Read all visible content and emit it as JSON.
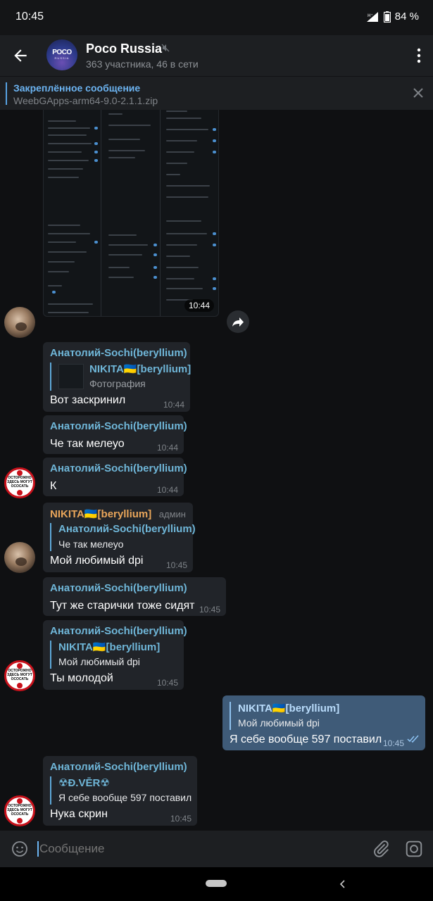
{
  "status": {
    "time": "10:45",
    "network": "H⁺",
    "battery": "84 %"
  },
  "header": {
    "title": "Poco Russia",
    "subtitle": "363 участника, 46 в сети",
    "avatar_logo": "POCO",
    "avatar_sub": "RUSSIA"
  },
  "pinned": {
    "title": "Закреплённое сообщение",
    "text": "WeebGApps-arm64-9.0-2.1.1.zip"
  },
  "photo_time": "10:44",
  "messages": [
    {
      "name": "Анатолий-Sochi(beryllium)",
      "reply_name": "NIKITA🇺🇦[beryllium]",
      "reply_text": "Фотография",
      "text": "Вот заскринил",
      "time": "10:44"
    },
    {
      "name": "Анатолий-Sochi(beryllium)",
      "text": "Че так мелеуо",
      "time": "10:44"
    },
    {
      "name": "Анатолий-Sochi(beryllium)",
      "text": "К",
      "time": "10:44"
    },
    {
      "name": "NIKITA🇺🇦[beryllium]",
      "role": "админ",
      "reply_name": "Анатолий-Sochi(beryllium)",
      "reply_text": "Че так мелеуо",
      "text": "Мой любимый dpi",
      "time": "10:45"
    },
    {
      "name": "Анатолий-Sochi(beryllium)",
      "text": "Тут же старички тоже сидят",
      "time": "10:45"
    },
    {
      "name": "Анатолий-Sochi(beryllium)",
      "reply_name": "NIKITA🇺🇦[beryllium]",
      "reply_text": "Мой любимый dpi",
      "text": "Ты молодой",
      "time": "10:45"
    },
    {
      "reply_name": "NIKITA🇺🇦[beryllium]",
      "reply_text": "Мой любимый dpi",
      "text": "Я себе вообще 597 поставил",
      "time": "10:45"
    },
    {
      "name": "Анатолий-Sochi(beryllium)",
      "reply_name": "☢Ð.VĒR☢",
      "reply_text": "Я себе вообще 597 поставил",
      "text": "Нука скрин",
      "time": "10:45"
    }
  ],
  "avatar_sign": {
    "text": "ОСТОРОЖНО ЗДЕСЬ МОГУТ ОСОСАТЬ"
  },
  "input": {
    "placeholder": "Сообщение"
  },
  "colors": {
    "accent": "#6cb4f2",
    "outgoing": "#3f5b78",
    "incoming": "#212429",
    "name": "#6fb6d8",
    "admin_name": "#e8a55a"
  }
}
